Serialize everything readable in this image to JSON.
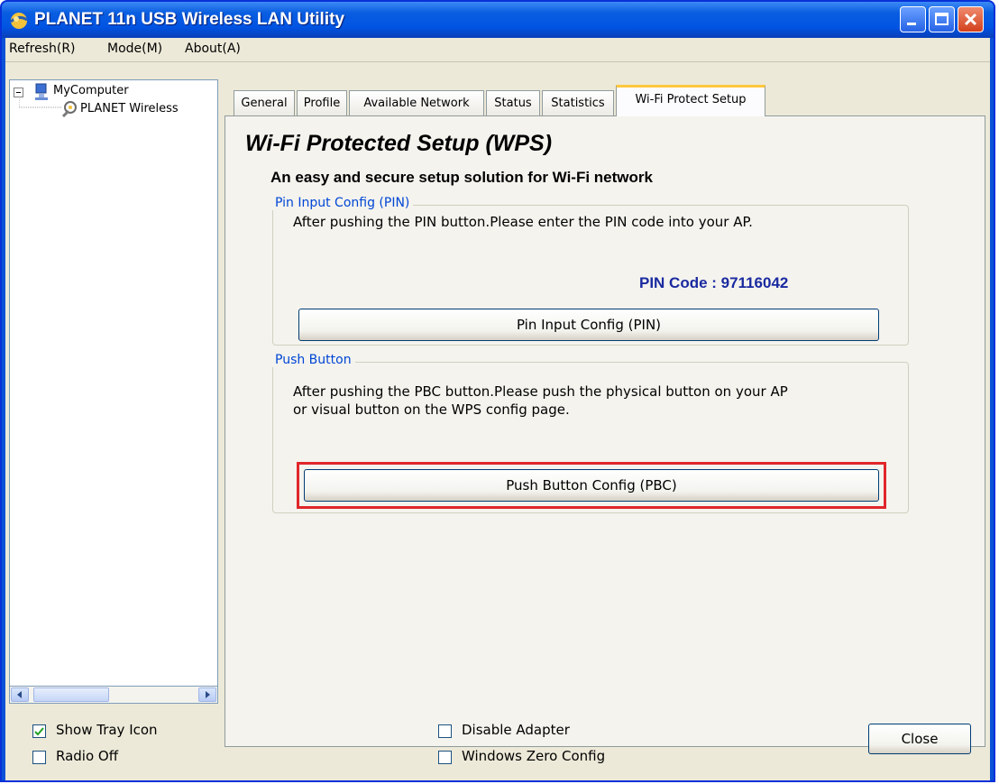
{
  "window": {
    "title": "PLANET 11n USB Wireless LAN Utility",
    "controls": [
      "minimize-icon",
      "maximize-icon",
      "close-icon"
    ]
  },
  "menu": [
    {
      "label": "Refresh(R)"
    },
    {
      "label": "Mode(M)"
    },
    {
      "label": "About(A)"
    }
  ],
  "tree": {
    "root": "MyComputer",
    "child": "PLANET Wireless"
  },
  "tabs": [
    {
      "label": "General"
    },
    {
      "label": "Profile"
    },
    {
      "label": "Available Network"
    },
    {
      "label": "Status"
    },
    {
      "label": "Statistics"
    },
    {
      "label": "Wi-Fi Protect Setup",
      "active": true
    }
  ],
  "wps": {
    "title": "Wi-Fi Protected Setup (WPS)",
    "subtitle": "An easy and secure setup solution for Wi-Fi network",
    "pin_group": {
      "legend": "Pin Input Config (PIN)",
      "description": "After pushing the PIN button.Please enter the PIN code into your AP.",
      "pin_code": "PIN Code :  97116042",
      "button": "Pin Input Config (PIN)"
    },
    "push_group": {
      "legend": "Push Button",
      "description_line1": "After pushing the PBC button.Please push the physical button on your AP",
      "description_line2": "or visual button on the WPS config page.",
      "button": "Push Button Config (PBC)"
    }
  },
  "footer": {
    "show_tray_icon": {
      "label": "Show Tray Icon",
      "checked": true
    },
    "radio_off": {
      "label": "Radio Off",
      "checked": false
    },
    "disable_adapter": {
      "label": "Disable Adapter",
      "checked": false
    },
    "windows_zero_config": {
      "label": "Windows Zero Config",
      "checked": false
    },
    "close_button": "Close"
  },
  "colors": {
    "titlebar": "#0054e3",
    "highlight": "#e0262a",
    "pin_code": "#1a2aa0",
    "group_legend": "#0046d5"
  }
}
